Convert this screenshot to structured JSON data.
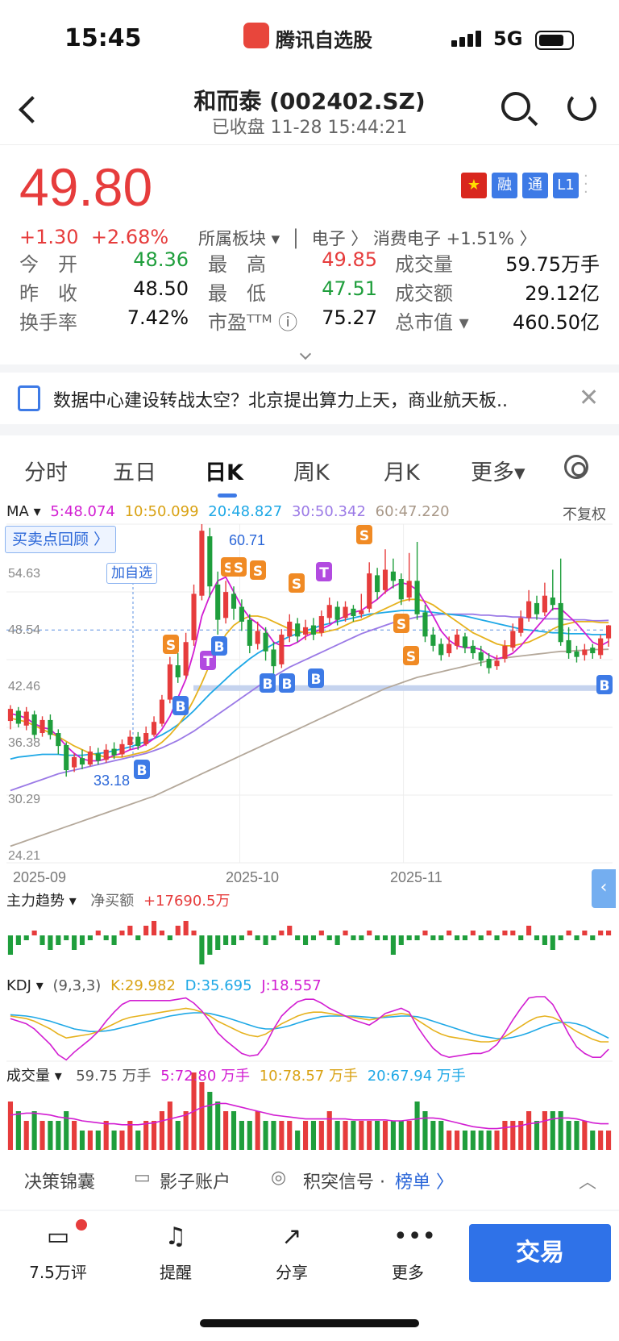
{
  "status": {
    "time": "15:45",
    "network": "5G",
    "app_name": "腾讯自选股"
  },
  "nav": {
    "title": "和而泰 (002402.SZ)",
    "subtitle": "已收盘   11-28 15:44:21"
  },
  "quote": {
    "price": "49.80",
    "change": "+1.30",
    "change_pct": "+2.68%",
    "sector_label": "所属板块 ▾",
    "sector_path": "电子 〉 消费电子 +1.51% 〉",
    "badges": [
      "融",
      "通",
      "L1"
    ],
    "rows": [
      {
        "l1": "今　开",
        "v1": "48.36",
        "l2": "最　高",
        "v2": "49.85",
        "l3": "成交量",
        "v3": "59.75万手"
      },
      {
        "l1": "昨　收",
        "v1": "48.50",
        "l2": "最　低",
        "v2": "47.51",
        "l3": "成交额",
        "v3": "29.12亿"
      },
      {
        "l1": "换手率",
        "v1": "7.42%",
        "l2": "市盈ᵀᵀᴹ ⓘ",
        "v2": "75.27",
        "l3": "总市值 ▾",
        "v3": "460.50亿"
      }
    ]
  },
  "news": {
    "text": "数据中心建设转战太空？北京提出算力上天，商业航天板.."
  },
  "tabs": [
    "分时",
    "五日",
    "日K",
    "周K",
    "月K",
    "更多▾"
  ],
  "ma_legend": {
    "label": "MA ▾",
    "ma5": "5:48.074",
    "ma10": "10:50.099",
    "ma20": "20:48.827",
    "ma30": "30:50.342",
    "ma60": "60:47.220",
    "adjust": "不复权"
  },
  "replay": "买卖点回顾 〉",
  "add_fav": "加自选",
  "main_flow": {
    "label": "主力趋势 ▾",
    "net_label": "净买额",
    "net_value": "+17690.5万"
  },
  "kdj": {
    "label": "KDJ ▾",
    "params": "(9,3,3)",
    "k": "K:29.982",
    "d": "D:35.695",
    "j": "J:18.557"
  },
  "volume": {
    "label": "成交量 ▾",
    "vol": "59.75 万手",
    "v5": "5:72.80 万手",
    "v10": "10:78.57 万手",
    "v20": "20:67.94 万手"
  },
  "tools": {
    "a": "决策锦囊",
    "b": "影子账户",
    "c": "积突信号 · ",
    "d": "榜单 〉"
  },
  "bottom": {
    "comments": "7.5万评",
    "alert": "提醒",
    "share": "分享",
    "more": "更多",
    "trade": "交易"
  },
  "colors": {
    "up": "#e63c3c",
    "down": "#1f9e3c",
    "accent": "#2f72e8",
    "ma5": "#d21ed2",
    "ma10": "#e6b21e",
    "ma20": "#1ea8e6",
    "ma30": "#9b7ae6",
    "ma60": "#b4a89a"
  },
  "chart_data": {
    "type": "candlestick",
    "y_ticks": [
      "54.63",
      "48.54",
      "42.46",
      "36.38",
      "30.29",
      "24.21"
    ],
    "x_ticks": [
      "2025-09",
      "2025-10",
      "2025-11"
    ],
    "annotations": {
      "high": "60.71",
      "low": "33.18"
    },
    "ylim": [
      24.21,
      60.71
    ],
    "candles": [
      [
        39.5,
        40.8,
        38.6,
        41.2
      ],
      [
        40.6,
        39.2,
        38.8,
        41.0
      ],
      [
        39.0,
        40.5,
        38.5,
        41.0
      ],
      [
        40.2,
        38.0,
        37.6,
        40.6
      ],
      [
        38.2,
        39.6,
        37.8,
        40.0
      ],
      [
        39.6,
        38.0,
        37.5,
        40.2
      ],
      [
        38.2,
        36.8,
        35.9,
        38.6
      ],
      [
        36.9,
        34.2,
        33.5,
        37.2
      ],
      [
        34.5,
        35.6,
        34.0,
        36.0
      ],
      [
        35.5,
        34.8,
        34.3,
        36.4
      ],
      [
        34.8,
        36.2,
        34.6,
        36.8
      ],
      [
        36.0,
        35.2,
        34.8,
        36.6
      ],
      [
        35.3,
        36.4,
        35.0,
        37.0
      ],
      [
        36.5,
        35.8,
        35.4,
        37.2
      ],
      [
        35.9,
        37.0,
        35.6,
        37.5
      ],
      [
        36.9,
        37.8,
        36.4,
        38.5
      ],
      [
        37.8,
        36.8,
        36.4,
        38.3
      ],
      [
        37.0,
        38.2,
        36.8,
        38.9
      ],
      [
        38.0,
        39.4,
        37.8,
        40.0
      ],
      [
        39.2,
        41.8,
        38.9,
        42.3
      ],
      [
        41.8,
        45.6,
        41.4,
        46.4
      ],
      [
        45.5,
        44.2,
        43.6,
        46.8
      ],
      [
        44.4,
        48.0,
        44.0,
        49.0
      ],
      [
        48.2,
        53.2,
        47.6,
        54.2
      ],
      [
        53.0,
        60.0,
        52.5,
        60.71
      ],
      [
        59.4,
        54.0,
        52.8,
        60.3
      ],
      [
        54.2,
        50.4,
        48.8,
        55.6
      ],
      [
        50.6,
        53.4,
        50.0,
        54.6
      ],
      [
        53.2,
        51.6,
        50.4,
        54.0
      ],
      [
        51.8,
        50.2,
        49.2,
        52.6
      ],
      [
        50.4,
        47.6,
        46.8,
        51.0
      ],
      [
        47.8,
        49.2,
        47.2,
        50.2
      ],
      [
        49.0,
        47.0,
        46.0,
        49.6
      ],
      [
        47.2,
        45.4,
        44.6,
        48.0
      ],
      [
        45.6,
        48.8,
        45.2,
        49.4
      ],
      [
        48.6,
        50.2,
        48.0,
        51.0
      ],
      [
        50.0,
        48.6,
        48.0,
        50.6
      ],
      [
        48.8,
        49.6,
        48.2,
        50.4
      ],
      [
        49.8,
        48.8,
        48.2,
        50.6
      ],
      [
        49.0,
        50.8,
        48.6,
        51.4
      ],
      [
        50.6,
        52.0,
        50.0,
        52.8
      ],
      [
        51.8,
        50.4,
        49.8,
        52.4
      ],
      [
        50.6,
        51.8,
        50.2,
        52.4
      ],
      [
        51.6,
        50.8,
        50.2,
        52.0
      ],
      [
        51.0,
        51.4,
        50.6,
        53.2
      ],
      [
        51.6,
        55.4,
        51.2,
        56.6
      ],
      [
        55.2,
        53.4,
        52.6,
        56.0
      ],
      [
        53.6,
        55.8,
        53.2,
        58.0
      ],
      [
        55.6,
        54.6,
        53.8,
        57.0
      ],
      [
        54.8,
        52.6,
        52.0,
        55.4
      ],
      [
        52.8,
        54.6,
        52.4,
        57.6
      ],
      [
        54.6,
        51.0,
        50.4,
        58.8
      ],
      [
        51.2,
        48.6,
        48.0,
        52.0
      ],
      [
        48.8,
        47.6,
        47.0,
        49.6
      ],
      [
        47.8,
        46.6,
        46.0,
        48.4
      ],
      [
        46.8,
        47.8,
        46.4,
        48.6
      ],
      [
        47.6,
        48.8,
        47.2,
        49.4
      ],
      [
        48.6,
        47.4,
        46.8,
        49.0
      ],
      [
        47.6,
        46.8,
        46.2,
        48.2
      ],
      [
        46.9,
        46.0,
        45.4,
        47.6
      ],
      [
        46.2,
        45.2,
        44.6,
        46.8
      ],
      [
        45.4,
        46.0,
        45.0,
        46.6
      ],
      [
        46.2,
        47.6,
        45.8,
        48.2
      ],
      [
        47.4,
        49.2,
        47.0,
        50.0
      ],
      [
        49.0,
        50.6,
        48.6,
        51.4
      ],
      [
        50.6,
        52.4,
        50.2,
        53.6
      ],
      [
        52.2,
        51.0,
        50.4,
        53.0
      ],
      [
        51.2,
        53.0,
        50.8,
        54.4
      ],
      [
        52.8,
        52.0,
        51.4,
        55.8
      ],
      [
        52.2,
        48.0,
        47.6,
        57.0
      ],
      [
        48.2,
        46.8,
        46.2,
        49.6
      ],
      [
        47.0,
        46.4,
        45.8,
        47.6
      ],
      [
        46.6,
        47.2,
        46.0,
        47.8
      ],
      [
        47.4,
        46.8,
        46.2,
        47.8
      ],
      [
        46.6,
        48.4,
        46.2,
        48.8
      ],
      [
        48.4,
        49.8,
        47.5,
        49.85
      ]
    ],
    "ma5": [
      40.3,
      40.1,
      39.8,
      39.2,
      38.8,
      38.6,
      37.8,
      36.8,
      36.0,
      35.4,
      35.2,
      35.2,
      35.4,
      35.8,
      36.0,
      36.4,
      36.6,
      37.0,
      37.6,
      38.6,
      40.0,
      42.0,
      44.0,
      47.0,
      50.8,
      53.0,
      54.6,
      55.0,
      53.4,
      51.8,
      50.6,
      50.0,
      49.2,
      48.0,
      47.6,
      47.6,
      48.0,
      48.6,
      49.0,
      49.4,
      49.8,
      50.4,
      50.8,
      51.2,
      51.4,
      52.0,
      52.6,
      53.4,
      54.0,
      54.4,
      54.2,
      53.6,
      52.2,
      50.8,
      49.2,
      48.2,
      47.6,
      47.4,
      47.4,
      47.2,
      46.6,
      46.2,
      46.4,
      46.8,
      47.6,
      48.6,
      49.6,
      50.6,
      51.6,
      51.6,
      50.8,
      50.0,
      49.0,
      48.0,
      47.6,
      48.07
    ],
    "ma10": [
      39.8,
      39.6,
      39.4,
      39.0,
      38.6,
      38.2,
      37.8,
      37.3,
      36.8,
      36.4,
      36.0,
      35.8,
      35.6,
      35.6,
      35.6,
      35.8,
      36.0,
      36.2,
      36.6,
      37.2,
      38.0,
      39.0,
      40.2,
      41.8,
      43.6,
      45.6,
      47.2,
      48.8,
      49.8,
      50.4,
      50.8,
      50.8,
      50.6,
      50.2,
      49.8,
      49.4,
      49.2,
      49.0,
      49.0,
      49.0,
      49.2,
      49.4,
      49.8,
      50.2,
      50.4,
      50.8,
      51.2,
      51.6,
      52.0,
      52.4,
      52.6,
      52.6,
      52.4,
      52.0,
      51.4,
      50.8,
      50.2,
      49.6,
      49.0,
      48.6,
      48.2,
      47.8,
      47.6,
      47.6,
      47.8,
      48.0,
      48.4,
      48.8,
      49.4,
      49.8,
      50.0,
      50.2,
      50.2,
      50.2,
      50.1,
      50.1
    ],
    "ma20": [
      35.4,
      35.6,
      35.7,
      35.8,
      35.9,
      35.9,
      35.9,
      35.8,
      35.8,
      35.8,
      35.9,
      36.0,
      36.1,
      36.3,
      36.5,
      36.7,
      37.0,
      37.3,
      37.6,
      38.0,
      38.5,
      39.1,
      39.8,
      40.6,
      41.5,
      42.4,
      43.2,
      44.0,
      44.8,
      45.5,
      46.2,
      46.8,
      47.3,
      47.8,
      48.2,
      48.6,
      48.9,
      49.2,
      49.5,
      49.8,
      50.0,
      50.2,
      50.4,
      50.6,
      50.8,
      51.0,
      51.1,
      51.2,
      51.3,
      51.4,
      51.4,
      51.4,
      51.3,
      51.2,
      51.1,
      51.0,
      50.9,
      50.8,
      50.6,
      50.4,
      50.2,
      50.0,
      49.8,
      49.6,
      49.4,
      49.3,
      49.2,
      49.1,
      49.0,
      49.0,
      48.9,
      48.9,
      48.9,
      48.8,
      48.8,
      48.83
    ],
    "ma30": [
      32.0,
      32.3,
      32.6,
      32.9,
      33.2,
      33.5,
      33.8,
      34.0,
      34.2,
      34.4,
      34.6,
      34.8,
      35.0,
      35.2,
      35.4,
      35.6,
      35.8,
      36.0,
      36.3,
      36.6,
      37.0,
      37.4,
      37.9,
      38.4,
      39.0,
      39.6,
      40.2,
      40.8,
      41.4,
      42.0,
      42.6,
      43.2,
      43.8,
      44.3,
      44.8,
      45.3,
      45.7,
      46.1,
      46.5,
      46.9,
      47.3,
      47.7,
      48.1,
      48.5,
      48.9,
      49.2,
      49.5,
      49.8,
      50.1,
      50.3,
      50.5,
      50.7,
      50.8,
      50.9,
      51.0,
      51.0,
      51.0,
      51.0,
      51.0,
      50.9,
      50.9,
      50.8,
      50.8,
      50.7,
      50.7,
      50.6,
      50.6,
      50.5,
      50.5,
      50.5,
      50.4,
      50.4,
      50.4,
      50.3,
      50.3,
      50.34
    ],
    "ma60": [
      26.0,
      26.3,
      26.6,
      26.9,
      27.2,
      27.5,
      27.8,
      28.1,
      28.4,
      28.7,
      29.0,
      29.3,
      29.6,
      29.9,
      30.2,
      30.5,
      30.8,
      31.1,
      31.4,
      31.8,
      32.2,
      32.6,
      33.0,
      33.4,
      33.8,
      34.2,
      34.6,
      35.0,
      35.4,
      35.8,
      36.2,
      36.6,
      37.0,
      37.4,
      37.8,
      38.2,
      38.6,
      39.0,
      39.4,
      39.8,
      40.2,
      40.6,
      41.0,
      41.4,
      41.8,
      42.2,
      42.6,
      43.0,
      43.3,
      43.6,
      43.9,
      44.2,
      44.4,
      44.6,
      44.8,
      45.0,
      45.2,
      45.4,
      45.6,
      45.8,
      46.0,
      46.2,
      46.3,
      46.4,
      46.5,
      46.6,
      46.7,
      46.8,
      46.9,
      47.0,
      47.0,
      47.1,
      47.1,
      47.2,
      47.2,
      47.22
    ],
    "flow": [
      -4,
      -2,
      -1,
      1,
      -2,
      -3,
      -2,
      -1,
      -3,
      -2,
      -1,
      1,
      -1,
      -2,
      1,
      2,
      -1,
      2,
      3,
      1,
      -1,
      2,
      3,
      1,
      -6,
      -4,
      -3,
      -2,
      -2,
      -1,
      1,
      -1,
      -2,
      -1,
      1,
      2,
      -1,
      -2,
      -1,
      1,
      -1,
      -2,
      1,
      -1,
      -1,
      1,
      -1,
      -1,
      -4,
      -2,
      -1,
      -1,
      1,
      -1,
      -1,
      1,
      -1,
      -1,
      1,
      -1,
      1,
      -1,
      1,
      1,
      -1,
      2,
      -1,
      -2,
      -3,
      -1,
      1,
      -1,
      1,
      -1,
      1,
      1
    ],
    "kdj_k": [
      70,
      68,
      66,
      62,
      56,
      50,
      42,
      36,
      38,
      40,
      42,
      46,
      52,
      58,
      64,
      68,
      70,
      72,
      74,
      76,
      78,
      80,
      82,
      80,
      76,
      70,
      62,
      56,
      50,
      44,
      40,
      38,
      42,
      50,
      58,
      64,
      70,
      74,
      76,
      76,
      74,
      72,
      70,
      68,
      66,
      64,
      66,
      70,
      72,
      74,
      72,
      64,
      56,
      48,
      42,
      38,
      36,
      34,
      32,
      30,
      30,
      32,
      38,
      46,
      54,
      62,
      68,
      70,
      68,
      62,
      54,
      46,
      40,
      34,
      30,
      29.98
    ],
    "kdj_d": [
      72,
      71,
      70,
      68,
      65,
      62,
      58,
      54,
      50,
      48,
      46,
      46,
      47,
      49,
      52,
      55,
      58,
      61,
      64,
      67,
      70,
      72,
      74,
      75,
      75,
      74,
      71,
      68,
      64,
      60,
      56,
      52,
      50,
      50,
      52,
      55,
      59,
      63,
      66,
      69,
      70,
      70,
      70,
      70,
      69,
      68,
      67,
      68,
      69,
      70,
      70,
      69,
      66,
      62,
      58,
      54,
      50,
      46,
      42,
      39,
      37,
      35,
      35,
      37,
      40,
      44,
      49,
      54,
      58,
      60,
      60,
      58,
      54,
      48,
      42,
      35.7
    ],
    "kdj_j": [
      66,
      62,
      58,
      50,
      38,
      26,
      10,
      2,
      14,
      24,
      34,
      46,
      62,
      76,
      88,
      94,
      94,
      94,
      94,
      94,
      94,
      96,
      98,
      90,
      78,
      62,
      44,
      32,
      22,
      12,
      8,
      10,
      26,
      50,
      70,
      82,
      92,
      96,
      96,
      90,
      82,
      76,
      70,
      64,
      60,
      56,
      64,
      74,
      78,
      82,
      76,
      54,
      36,
      20,
      10,
      6,
      8,
      10,
      12,
      12,
      16,
      26,
      44,
      64,
      82,
      98,
      100,
      100,
      88,
      66,
      42,
      22,
      12,
      6,
      6,
      18.56
    ],
    "vol": [
      5,
      4,
      3,
      4,
      3,
      3,
      3,
      4,
      3,
      2,
      2,
      2,
      3,
      2,
      2,
      3,
      2,
      3,
      3,
      4,
      5,
      3,
      4,
      8,
      7,
      6,
      5,
      4,
      4,
      3,
      3,
      4,
      3,
      3,
      3,
      3,
      2,
      3,
      3,
      3,
      4,
      3,
      3,
      3,
      3,
      3,
      3,
      3,
      3,
      3,
      3,
      5,
      4,
      3,
      3,
      2,
      2,
      2,
      2,
      2,
      2,
      2,
      3,
      3,
      3,
      4,
      3,
      4,
      4,
      4,
      3,
      3,
      3,
      2,
      2,
      2
    ],
    "vol_ma": [
      3.6,
      3.7,
      3.8,
      3.8,
      3.7,
      3.6,
      3.4,
      3.3,
      3.2,
      3.0,
      2.9,
      2.8,
      2.7,
      2.7,
      2.6,
      2.6,
      2.6,
      2.7,
      2.8,
      3.0,
      3.2,
      3.4,
      3.6,
      4.0,
      4.4,
      4.6,
      4.8,
      4.8,
      4.6,
      4.4,
      4.2,
      4.0,
      3.8,
      3.6,
      3.5,
      3.4,
      3.3,
      3.2,
      3.2,
      3.2,
      3.2,
      3.2,
      3.2,
      3.1,
      3.1,
      3.1,
      3.1,
      3.1,
      3.0,
      3.0,
      3.1,
      3.2,
      3.3,
      3.3,
      3.2,
      3.0,
      2.8,
      2.6,
      2.4,
      2.3,
      2.2,
      2.2,
      2.3,
      2.4,
      2.5,
      2.7,
      2.8,
      3.0,
      3.2,
      3.3,
      3.3,
      3.2,
      3.0,
      2.8,
      2.7,
      2.7
    ]
  }
}
